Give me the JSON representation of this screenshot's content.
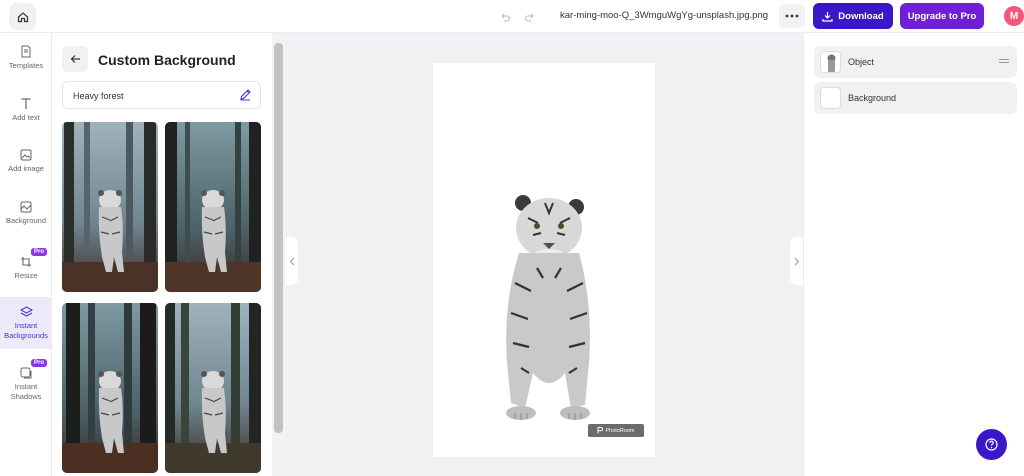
{
  "topbar": {
    "filename": "kar-ming-moo-Q_3WmguWgYg-unsplash.jpg.png",
    "download_label": "Download",
    "upgrade_label": "Upgrade to Pro",
    "avatar_initial": "M"
  },
  "rail": {
    "items": [
      {
        "label": "Templates",
        "icon": "document-icon"
      },
      {
        "label": "Add text",
        "icon": "text-icon"
      },
      {
        "label": "Add image",
        "icon": "image-icon"
      },
      {
        "label": "Background",
        "icon": "background-icon"
      },
      {
        "label": "Resize",
        "icon": "crop-icon",
        "badge": "Pro"
      },
      {
        "label": "Instant Backgrounds",
        "icon": "layers-icon",
        "active": true
      },
      {
        "label": "Instant Shadows",
        "icon": "shadow-icon",
        "badge": "Pro"
      }
    ]
  },
  "panel": {
    "title": "Custom Background",
    "prompt_value": "Heavy forest"
  },
  "canvas": {
    "watermark": "PhotoRoom"
  },
  "layers": {
    "items": [
      {
        "label": "Object"
      },
      {
        "label": "Background"
      }
    ]
  },
  "colors": {
    "accent": "#3a18c9",
    "pro": "#6e1fd7",
    "active_bg": "#eceaf8"
  }
}
